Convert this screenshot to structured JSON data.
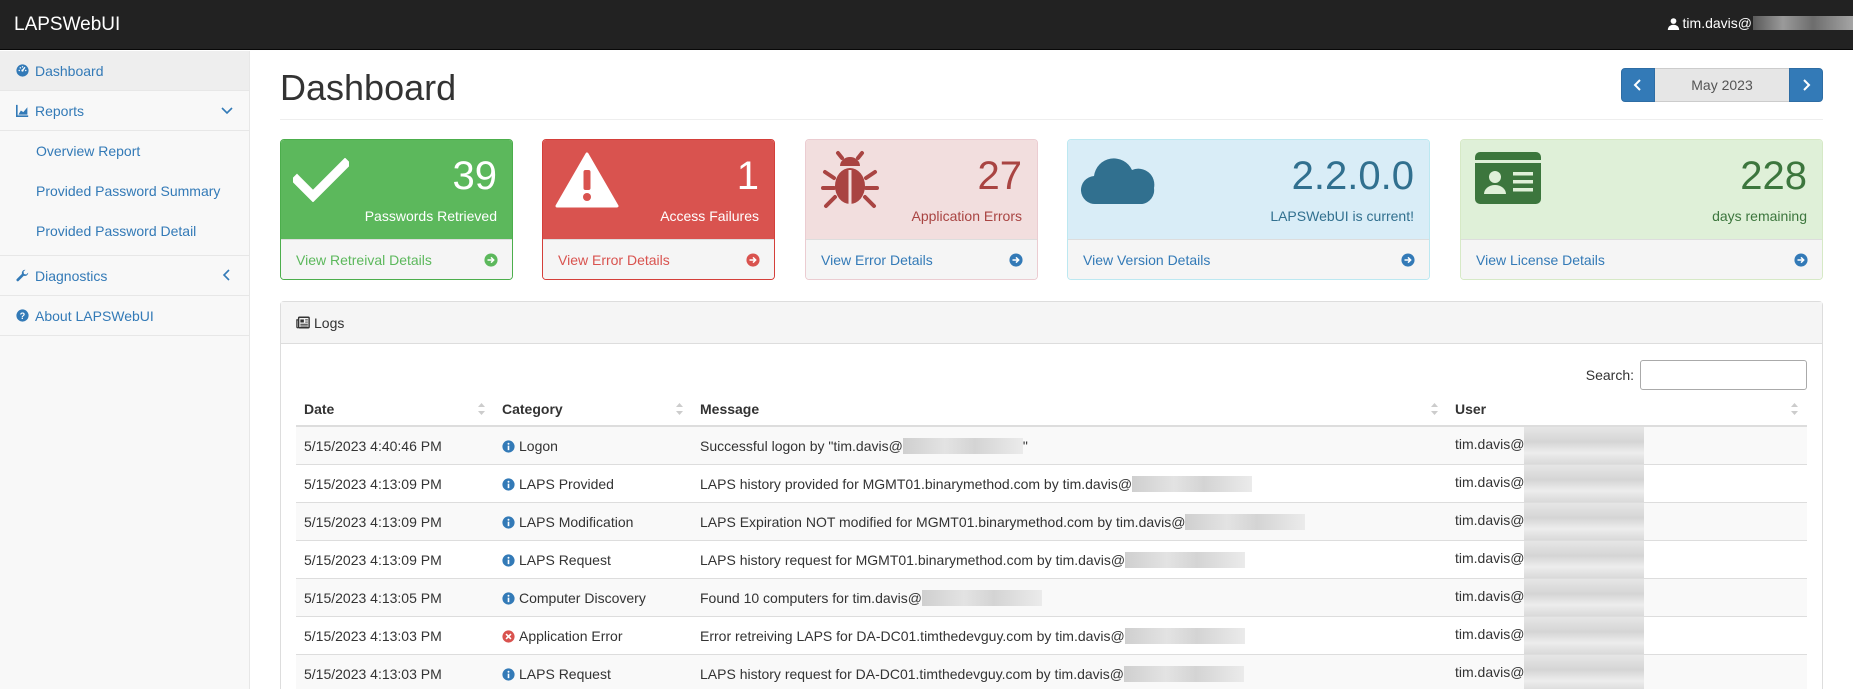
{
  "app": {
    "brand": "LAPSWebUI",
    "user_prefix": "tim.davis@"
  },
  "sidebar": {
    "dashboard": "Dashboard",
    "reports": "Reports",
    "reports_items": [
      "Overview Report",
      "Provided Password Summary",
      "Provided Password Detail"
    ],
    "diagnostics": "Diagnostics",
    "about": "About LAPSWebUI"
  },
  "header": {
    "title": "Dashboard",
    "month": "May 2023"
  },
  "cards": [
    {
      "value": "39",
      "label": "Passwords Retrieved",
      "link": "View Retreival Details",
      "icon": "check-icon"
    },
    {
      "value": "1",
      "label": "Access Failures",
      "link": "View Error Details",
      "icon": "warning-icon"
    },
    {
      "value": "27",
      "label": "Application Errors",
      "link": "View Error Details",
      "icon": "bug-icon"
    },
    {
      "value": "2.2.0.0",
      "label": "LAPSWebUI is current!",
      "link": "View Version Details",
      "icon": "cloud-icon"
    },
    {
      "value": "228",
      "label": "days remaining",
      "link": "View License Details",
      "icon": "id-card-icon"
    }
  ],
  "logs": {
    "title": "Logs",
    "search_label": "Search:",
    "columns": [
      "Date",
      "Category",
      "Message",
      "User"
    ],
    "rows": [
      {
        "date": "5/15/2023 4:40:46 PM",
        "category": "Logon",
        "type": "info",
        "message": "Successful logon by \"tim.davis@",
        "message_suffix": "\"",
        "user": "tim.davis@"
      },
      {
        "date": "5/15/2023 4:13:09 PM",
        "category": "LAPS Provided",
        "type": "info",
        "message": "LAPS history provided for MGMT01.binarymethod.com by tim.davis@",
        "message_suffix": "",
        "user": "tim.davis@"
      },
      {
        "date": "5/15/2023 4:13:09 PM",
        "category": "LAPS Modification",
        "type": "info",
        "message": "LAPS Expiration NOT modified for MGMT01.binarymethod.com by tim.davis@",
        "message_suffix": "",
        "user": "tim.davis@"
      },
      {
        "date": "5/15/2023 4:13:09 PM",
        "category": "LAPS Request",
        "type": "info",
        "message": "LAPS history request for MGMT01.binarymethod.com by tim.davis@",
        "message_suffix": "",
        "user": "tim.davis@"
      },
      {
        "date": "5/15/2023 4:13:05 PM",
        "category": "Computer Discovery",
        "type": "info",
        "message": "Found 10 computers for tim.davis@",
        "message_suffix": "",
        "user": "tim.davis@"
      },
      {
        "date": "5/15/2023 4:13:03 PM",
        "category": "Application Error",
        "type": "error",
        "message": "Error retreiving LAPS for DA-DC01.timthedevguy.com by tim.davis@",
        "message_suffix": "",
        "user": "tim.davis@"
      },
      {
        "date": "5/15/2023 4:13:03 PM",
        "category": "LAPS Request",
        "type": "info",
        "message": "LAPS history request for DA-DC01.timthedevguy.com by tim.davis@",
        "message_suffix": "",
        "user": "tim.davis@"
      }
    ]
  },
  "colors": {
    "primary": "#337ab7",
    "success": "#5cb85c",
    "danger": "#d9534f",
    "navbar": "#222222"
  }
}
